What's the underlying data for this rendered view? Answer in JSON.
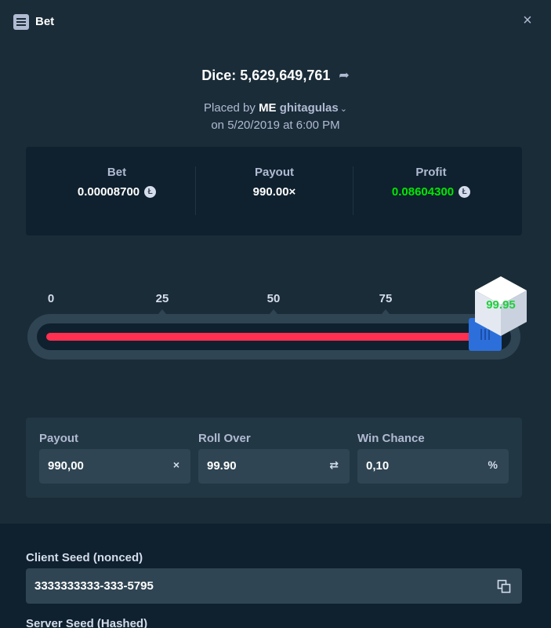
{
  "header": {
    "title": "Bet",
    "close_label": "×"
  },
  "bet": {
    "title": "Dice: 5,629,649,761",
    "placed_by_prefix": "Placed by",
    "placed_by_tag": "ME",
    "placed_by_user": "ghitagulas",
    "placed_on": "on 5/20/2019 at 6:00 PM"
  },
  "stats": {
    "bet_label": "Bet",
    "bet_value": "0.00008700",
    "payout_label": "Payout",
    "payout_value": "990.00×",
    "profit_label": "Profit",
    "profit_value": "0.08604300"
  },
  "slider": {
    "ticks": [
      "0",
      "25",
      "50",
      "75"
    ],
    "result": "99.95",
    "fill_percent": 99.9,
    "colors": {
      "fill": "#ff2f51",
      "handle": "#2c6fdb",
      "result": "#1fcf3c"
    }
  },
  "fields": {
    "payout_label": "Payout",
    "payout_value": "990,00",
    "payout_suffix": "×",
    "roll_over_label": "Roll Over",
    "roll_over_value": "99.90",
    "roll_over_suffix": "⇄",
    "win_chance_label": "Win Chance",
    "win_chance_value": "0,10",
    "win_chance_suffix": "%"
  },
  "seeds": {
    "client_seed_label": "Client Seed (nonced)",
    "client_seed_value": "3333333333-333-5795",
    "server_seed_label": "Server Seed (Hashed)"
  },
  "colors": {
    "background": "#1a2c38",
    "panel": "#0f212e",
    "profit_green": "#00e701"
  }
}
